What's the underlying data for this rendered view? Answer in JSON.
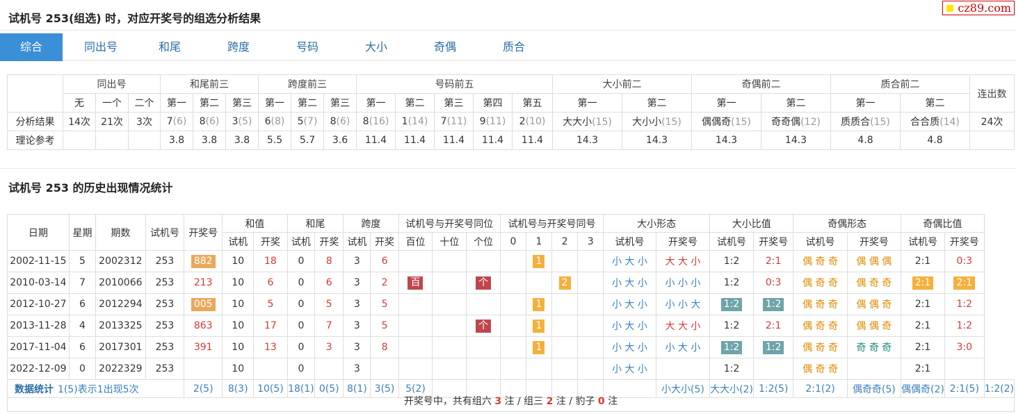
{
  "header": {
    "title": "试机号 253(组选) 时，对应开奖号的组选分析结果",
    "logo": "cz89.com"
  },
  "tabs": [
    "综合",
    "同出号",
    "和尾",
    "跨度",
    "号码",
    "大小",
    "奇偶",
    "质合"
  ],
  "t1": {
    "groups": [
      "同出号",
      "和尾前三",
      "跨度前三",
      "号码前五",
      "大小前二",
      "奇偶前二",
      "质合前二",
      "连出数"
    ],
    "subs": [
      "无",
      "一个",
      "二个",
      "第一",
      "第二",
      "第三",
      "第一",
      "第二",
      "第三",
      "第一",
      "第二",
      "第三",
      "第四",
      "第五",
      "第一",
      "第二",
      "第一",
      "第二",
      "第一",
      "第二"
    ],
    "row1_label": "分析结果",
    "row1": [
      {
        "v": "14次"
      },
      {
        "v": "21次"
      },
      {
        "v": "3次"
      },
      {
        "v": "7",
        "c": "(6)"
      },
      {
        "v": "8",
        "c": "(6)"
      },
      {
        "v": "3",
        "c": "(5)"
      },
      {
        "v": "6",
        "c": "(8)"
      },
      {
        "v": "5",
        "c": "(7)"
      },
      {
        "v": "8",
        "c": "(6)"
      },
      {
        "v": "8",
        "c": "(16)"
      },
      {
        "v": "1",
        "c": "(14)"
      },
      {
        "v": "7",
        "c": "(11)"
      },
      {
        "v": "9",
        "c": "(11)"
      },
      {
        "v": "2",
        "c": "(10)"
      },
      {
        "v": "大大小",
        "c": "(15)"
      },
      {
        "v": "大小小",
        "c": "(15)"
      },
      {
        "v": "偶偶奇",
        "c": "(15)"
      },
      {
        "v": "奇奇偶",
        "c": "(12)"
      },
      {
        "v": "质质合",
        "c": "(15)"
      },
      {
        "v": "合合质",
        "c": "(14)"
      },
      {
        "v": "24次"
      }
    ],
    "row2_label": "理论参考",
    "row2": [
      "",
      "",
      "",
      "3.8",
      "3.8",
      "3.8",
      "5.5",
      "5.7",
      "3.6",
      "11.4",
      "11.4",
      "11.4",
      "11.4",
      "11.4",
      "14.3",
      "14.3",
      "14.3",
      "14.3",
      "4.8",
      "4.8",
      ""
    ]
  },
  "sec2_title": "试机号 253 的历史出现情况统计",
  "t2": {
    "h1": [
      "日期",
      "星期",
      "期数",
      "试机号",
      "开奖号",
      "和值",
      "和尾",
      "跨度",
      "试机号与开奖号同位",
      "试机号与开奖号同号",
      "大小形态",
      "大小比值",
      "奇偶形态",
      "奇偶比值"
    ],
    "h2": [
      "试机",
      "开奖",
      "试机",
      "开奖",
      "试机",
      "开奖",
      "百位",
      "十位",
      "个位",
      "0",
      "1",
      "2",
      "3",
      "试机号",
      "开奖号",
      "试机号",
      "开奖号",
      "试机号",
      "开奖号",
      "试机号",
      "开奖号"
    ],
    "rows": [
      {
        "date": "2002-11-15",
        "week": "5",
        "issue": "2002312",
        "try": "253",
        "open": "882",
        "ob": "o",
        "hs": "10",
        "ho": "18",
        "ws": "0",
        "wo": "8",
        "ks": "3",
        "ko": "6",
        "pos": [
          "",
          "",
          ""
        ],
        "num": [
          "",
          "1",
          "",
          ""
        ],
        "dxs": "小 大 小",
        "dxo": "大 大 小",
        "rs": "1:2",
        "ro": "2:1",
        "rsb": "",
        "rob": "",
        "jos": "偶 奇 奇",
        "joo": "偶 偶 偶",
        "es": "2:1",
        "eo": "0:3",
        "esb": "",
        "eob": ""
      },
      {
        "date": "2010-03-14",
        "week": "7",
        "issue": "2010066",
        "try": "253",
        "open": "213",
        "ob": "",
        "hs": "10",
        "ho": "6",
        "ws": "0",
        "wo": "6",
        "ks": "3",
        "ko": "2",
        "pos": [
          "百",
          "",
          "个"
        ],
        "num": [
          "",
          "",
          "2",
          ""
        ],
        "dxs": "小 大 小",
        "dxo": "小 小 小",
        "rs": "1:2",
        "ro": "0:3",
        "rsb": "",
        "rob": "",
        "jos": "偶 奇 奇",
        "joo": "偶 奇 奇",
        "es": "2:1",
        "eo": "2:1",
        "esb": "y",
        "eob": "y"
      },
      {
        "date": "2012-10-27",
        "week": "6",
        "issue": "2012294",
        "try": "253",
        "open": "005",
        "ob": "o",
        "hs": "10",
        "ho": "5",
        "ws": "0",
        "wo": "5",
        "ks": "3",
        "ko": "5",
        "pos": [
          "",
          "",
          ""
        ],
        "num": [
          "",
          "1",
          "",
          ""
        ],
        "dxs": "小 大 小",
        "dxo": "小 小 大",
        "rs": "1:2",
        "ro": "1:2",
        "rsb": "g",
        "rob": "g",
        "jos": "偶 奇 奇",
        "joo": "偶 偶 奇",
        "es": "2:1",
        "eo": "1:2",
        "esb": "",
        "eob": ""
      },
      {
        "date": "2013-11-28",
        "week": "4",
        "issue": "2013325",
        "try": "253",
        "open": "863",
        "ob": "",
        "hs": "10",
        "ho": "17",
        "ws": "0",
        "wo": "7",
        "ks": "3",
        "ko": "5",
        "pos": [
          "",
          "",
          "个"
        ],
        "num": [
          "",
          "1",
          "",
          ""
        ],
        "dxs": "小 大 小",
        "dxo": "大 大 小",
        "rs": "1:2",
        "ro": "2:1",
        "rsb": "",
        "rob": "",
        "jos": "偶 奇 奇",
        "joo": "偶 偶 奇",
        "es": "2:1",
        "eo": "1:2",
        "esb": "",
        "eob": ""
      },
      {
        "date": "2017-11-04",
        "week": "6",
        "issue": "2017301",
        "try": "253",
        "open": "391",
        "ob": "",
        "hs": "10",
        "ho": "13",
        "ws": "0",
        "wo": "3",
        "ks": "3",
        "ko": "8",
        "pos": [
          "",
          "",
          ""
        ],
        "num": [
          "",
          "1",
          "",
          ""
        ],
        "dxs": "小 大 小",
        "dxo": "小 大 小",
        "rs": "1:2",
        "ro": "1:2",
        "rsb": "g",
        "rob": "g",
        "jos": "偶 奇 奇",
        "joo": "奇 奇 奇",
        "es": "2:1",
        "eo": "3:0",
        "esb": "",
        "eob": ""
      },
      {
        "date": "2022-12-09",
        "week": "0",
        "issue": "2022329",
        "try": "253",
        "open": "",
        "ob": "",
        "hs": "10",
        "ho": "",
        "ws": "0",
        "wo": "",
        "ks": "3",
        "ko": "",
        "pos": [
          "",
          "",
          ""
        ],
        "num": [
          "",
          "",
          "",
          ""
        ],
        "dxs": "小 大 小",
        "dxo": "",
        "rs": "1:2",
        "ro": "",
        "rsb": "",
        "rob": "",
        "jos": "偶 奇 奇",
        "joo": "",
        "es": "2:1",
        "eo": "",
        "esb": "",
        "eob": ""
      }
    ],
    "stat": {
      "label": "数据统计",
      "note": "1(5)表示1出现5次",
      "try": "2(5)",
      "open": "8(3)",
      "hs": "10(5)",
      "ho": "18(1)",
      "ws": "0(5)",
      "wo": "8(1)",
      "ks": "3(5)",
      "ko": "5(2)",
      "dxs": "小大小(5)",
      "dxo": "大大小(2)",
      "rs": "1:2(5)",
      "ro": "2:1(2)",
      "jos": "偶奇奇(5)",
      "joo": "偶偶奇(2)",
      "es": "2:1(5)",
      "eo": "1:2(2)"
    }
  },
  "footer": {
    "pre": "开奖号中，共有组六",
    "n1": "3",
    "m1": "注 / 组三",
    "n2": "2",
    "m2": "注 / 豹子",
    "n3": "0",
    "m3": "注"
  }
}
